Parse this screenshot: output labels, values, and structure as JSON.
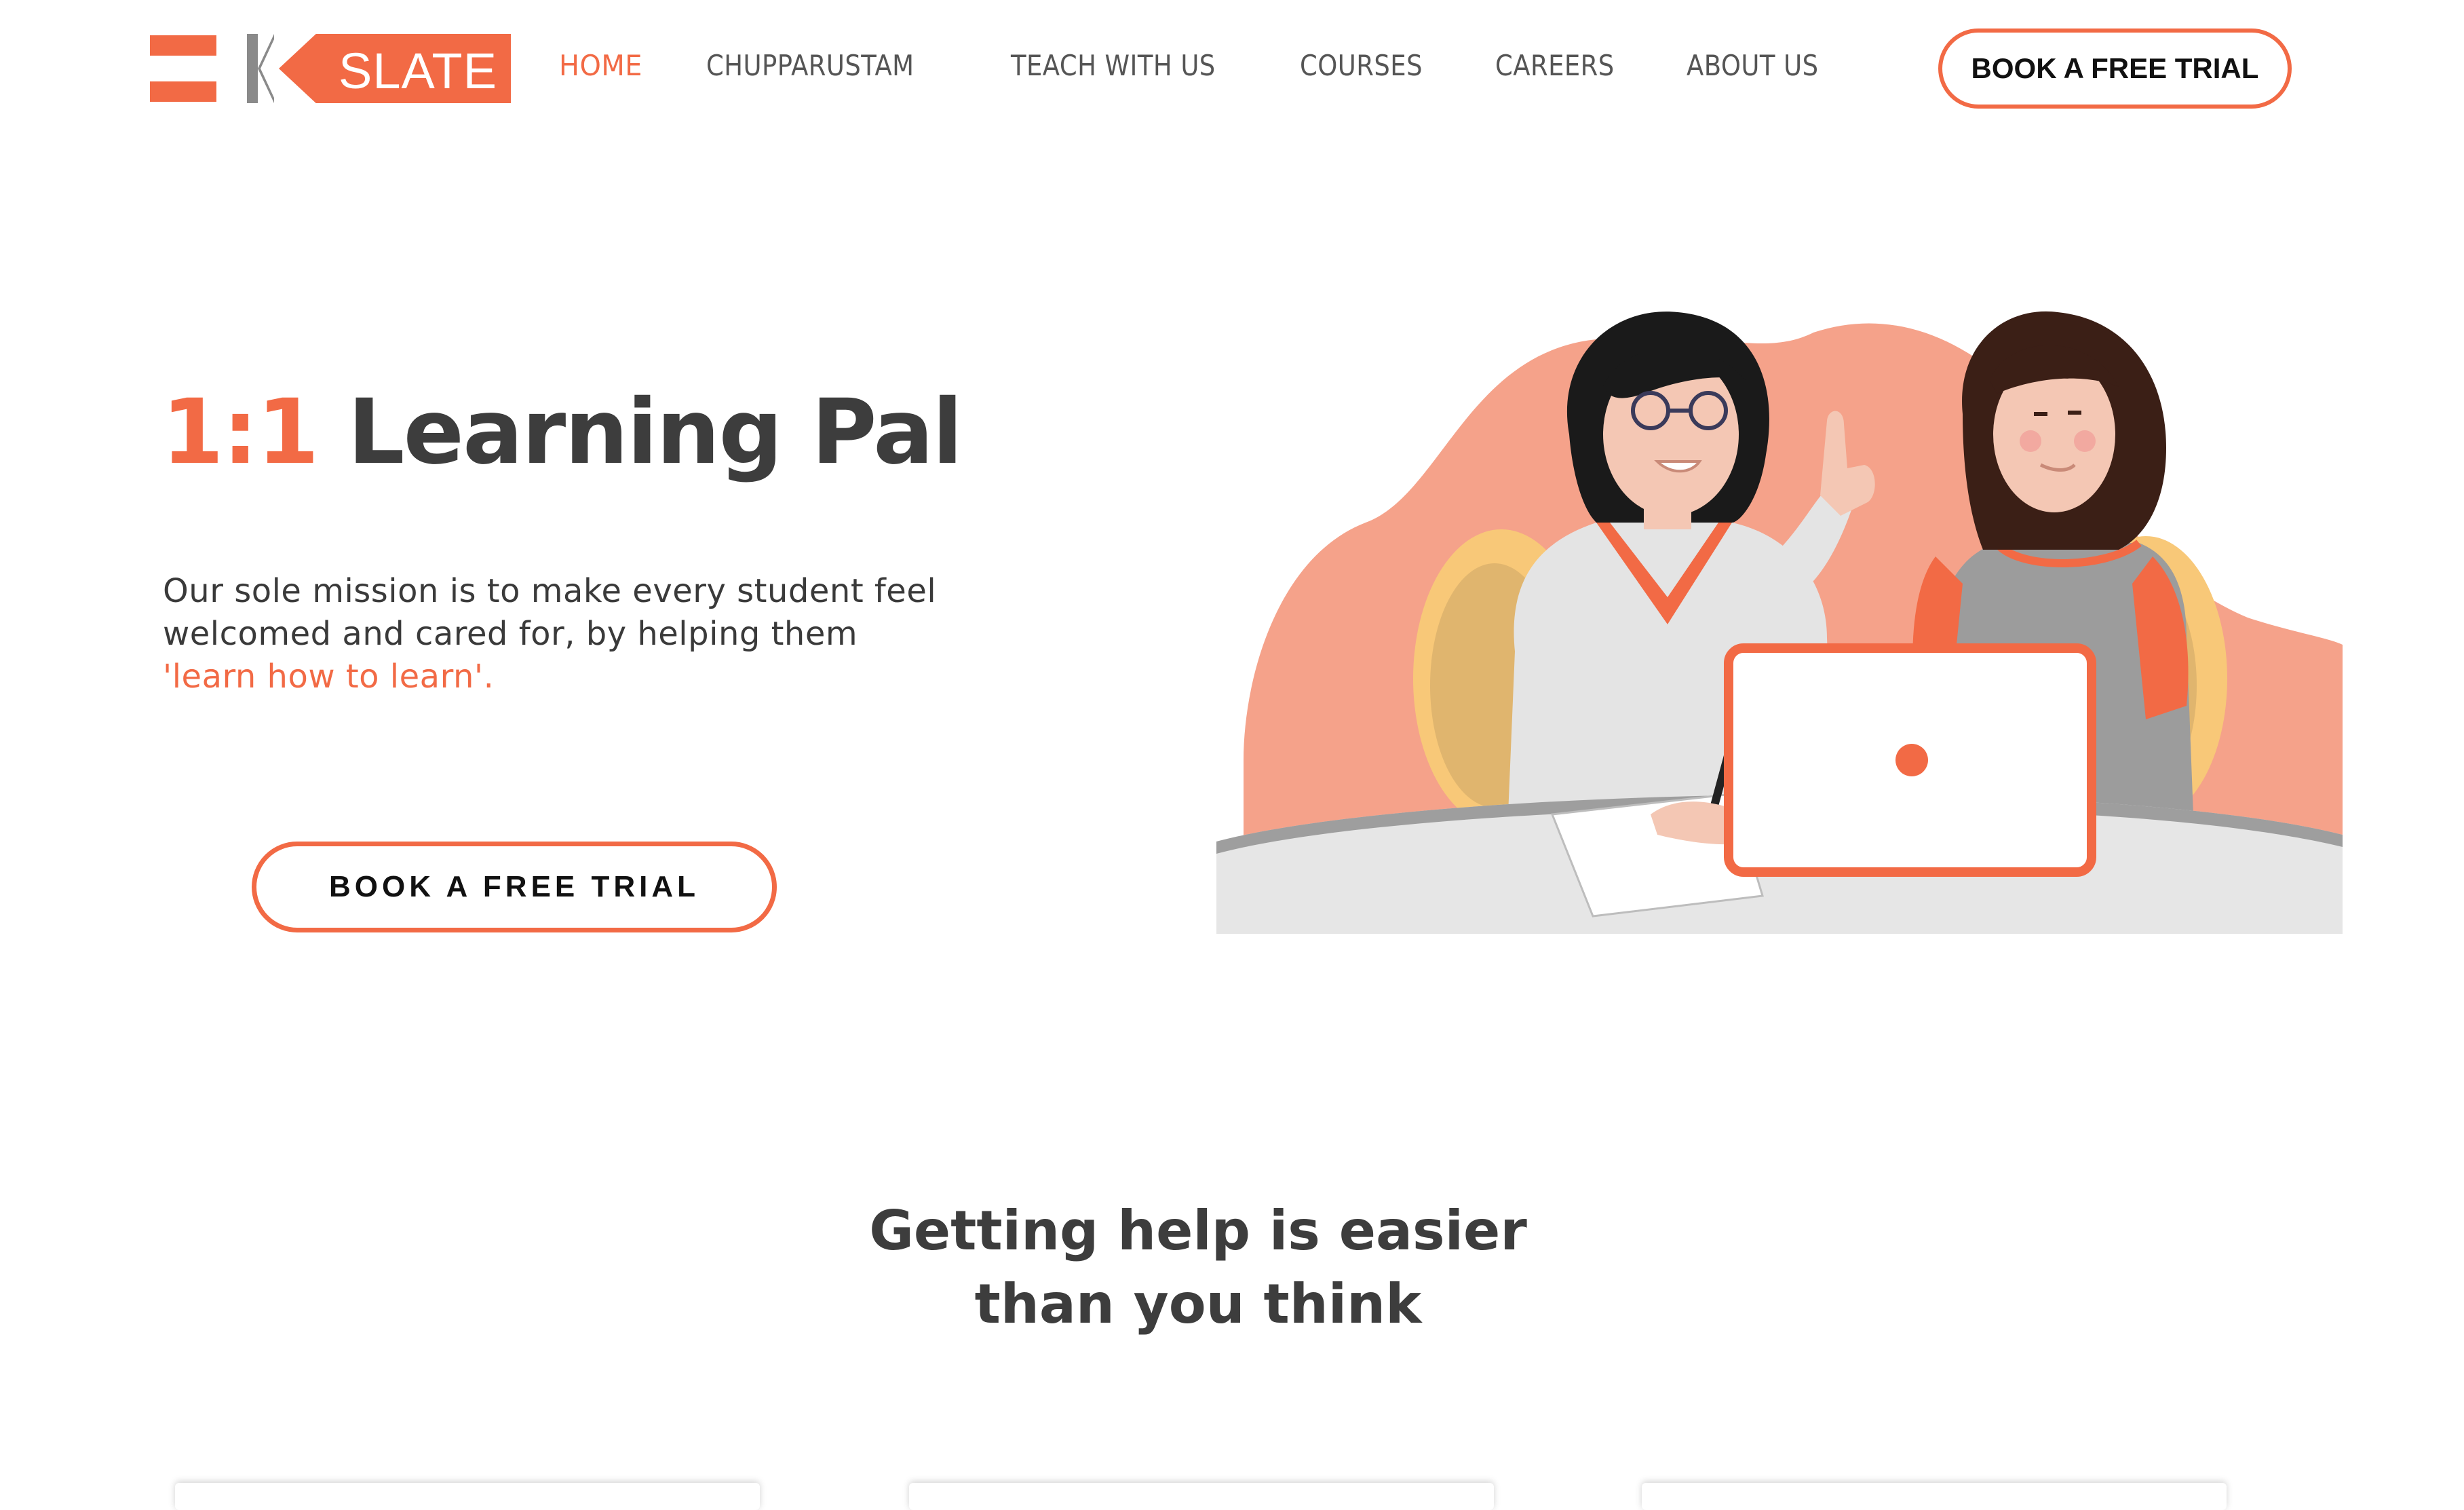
{
  "brand": {
    "logo_text": "SLATE",
    "accent_color": "#f26a45",
    "text_color": "#3d3d3d"
  },
  "nav": {
    "items": [
      {
        "label": "HOME",
        "active": true
      },
      {
        "label": "CHUPPARUSTAM",
        "active": false
      },
      {
        "label": "TEACH WITH US",
        "active": false
      },
      {
        "label": "COURSES",
        "active": false
      },
      {
        "label": "CAREERS",
        "active": false
      },
      {
        "label": "ABOUT US",
        "active": false
      }
    ],
    "cta_label": "BOOK A FREE TRIAL"
  },
  "hero": {
    "title_accent": "1:1",
    "title_rest": " Learning Pal",
    "description": "Our sole mission is to make every student feel welcomed and cared for, by helping them",
    "description_highlight": "'learn how to learn'.",
    "cta_label": "BOOK A FREE TRIAL",
    "illustration": "two-women-with-laptop-illustration"
  },
  "help_section": {
    "title_line1": "Getting help is easier",
    "title_line2": "than you think"
  }
}
